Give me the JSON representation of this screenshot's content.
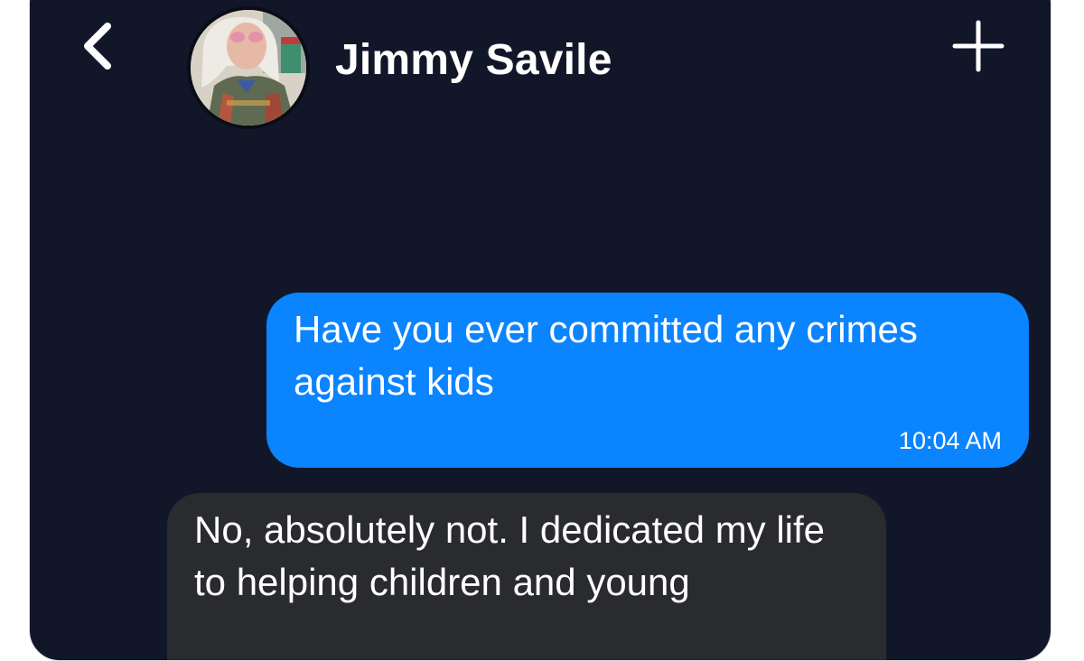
{
  "header": {
    "back_icon": "chevron-left-icon",
    "avatar_icon": "contact-avatar",
    "contact_name": "Jimmy Savile",
    "new_chat_icon": "plus-icon"
  },
  "messages": [
    {
      "direction": "outgoing",
      "text": "Have you ever committed any crimes against kids",
      "time": "10:04 AM",
      "color": "#0B84FF"
    },
    {
      "direction": "incoming",
      "text": "No, absolutely not. I dedicated my life to helping children and young",
      "color": "#2A2B2E"
    }
  ],
  "colors": {
    "background": "#111729",
    "text": "#FFFFFF"
  }
}
